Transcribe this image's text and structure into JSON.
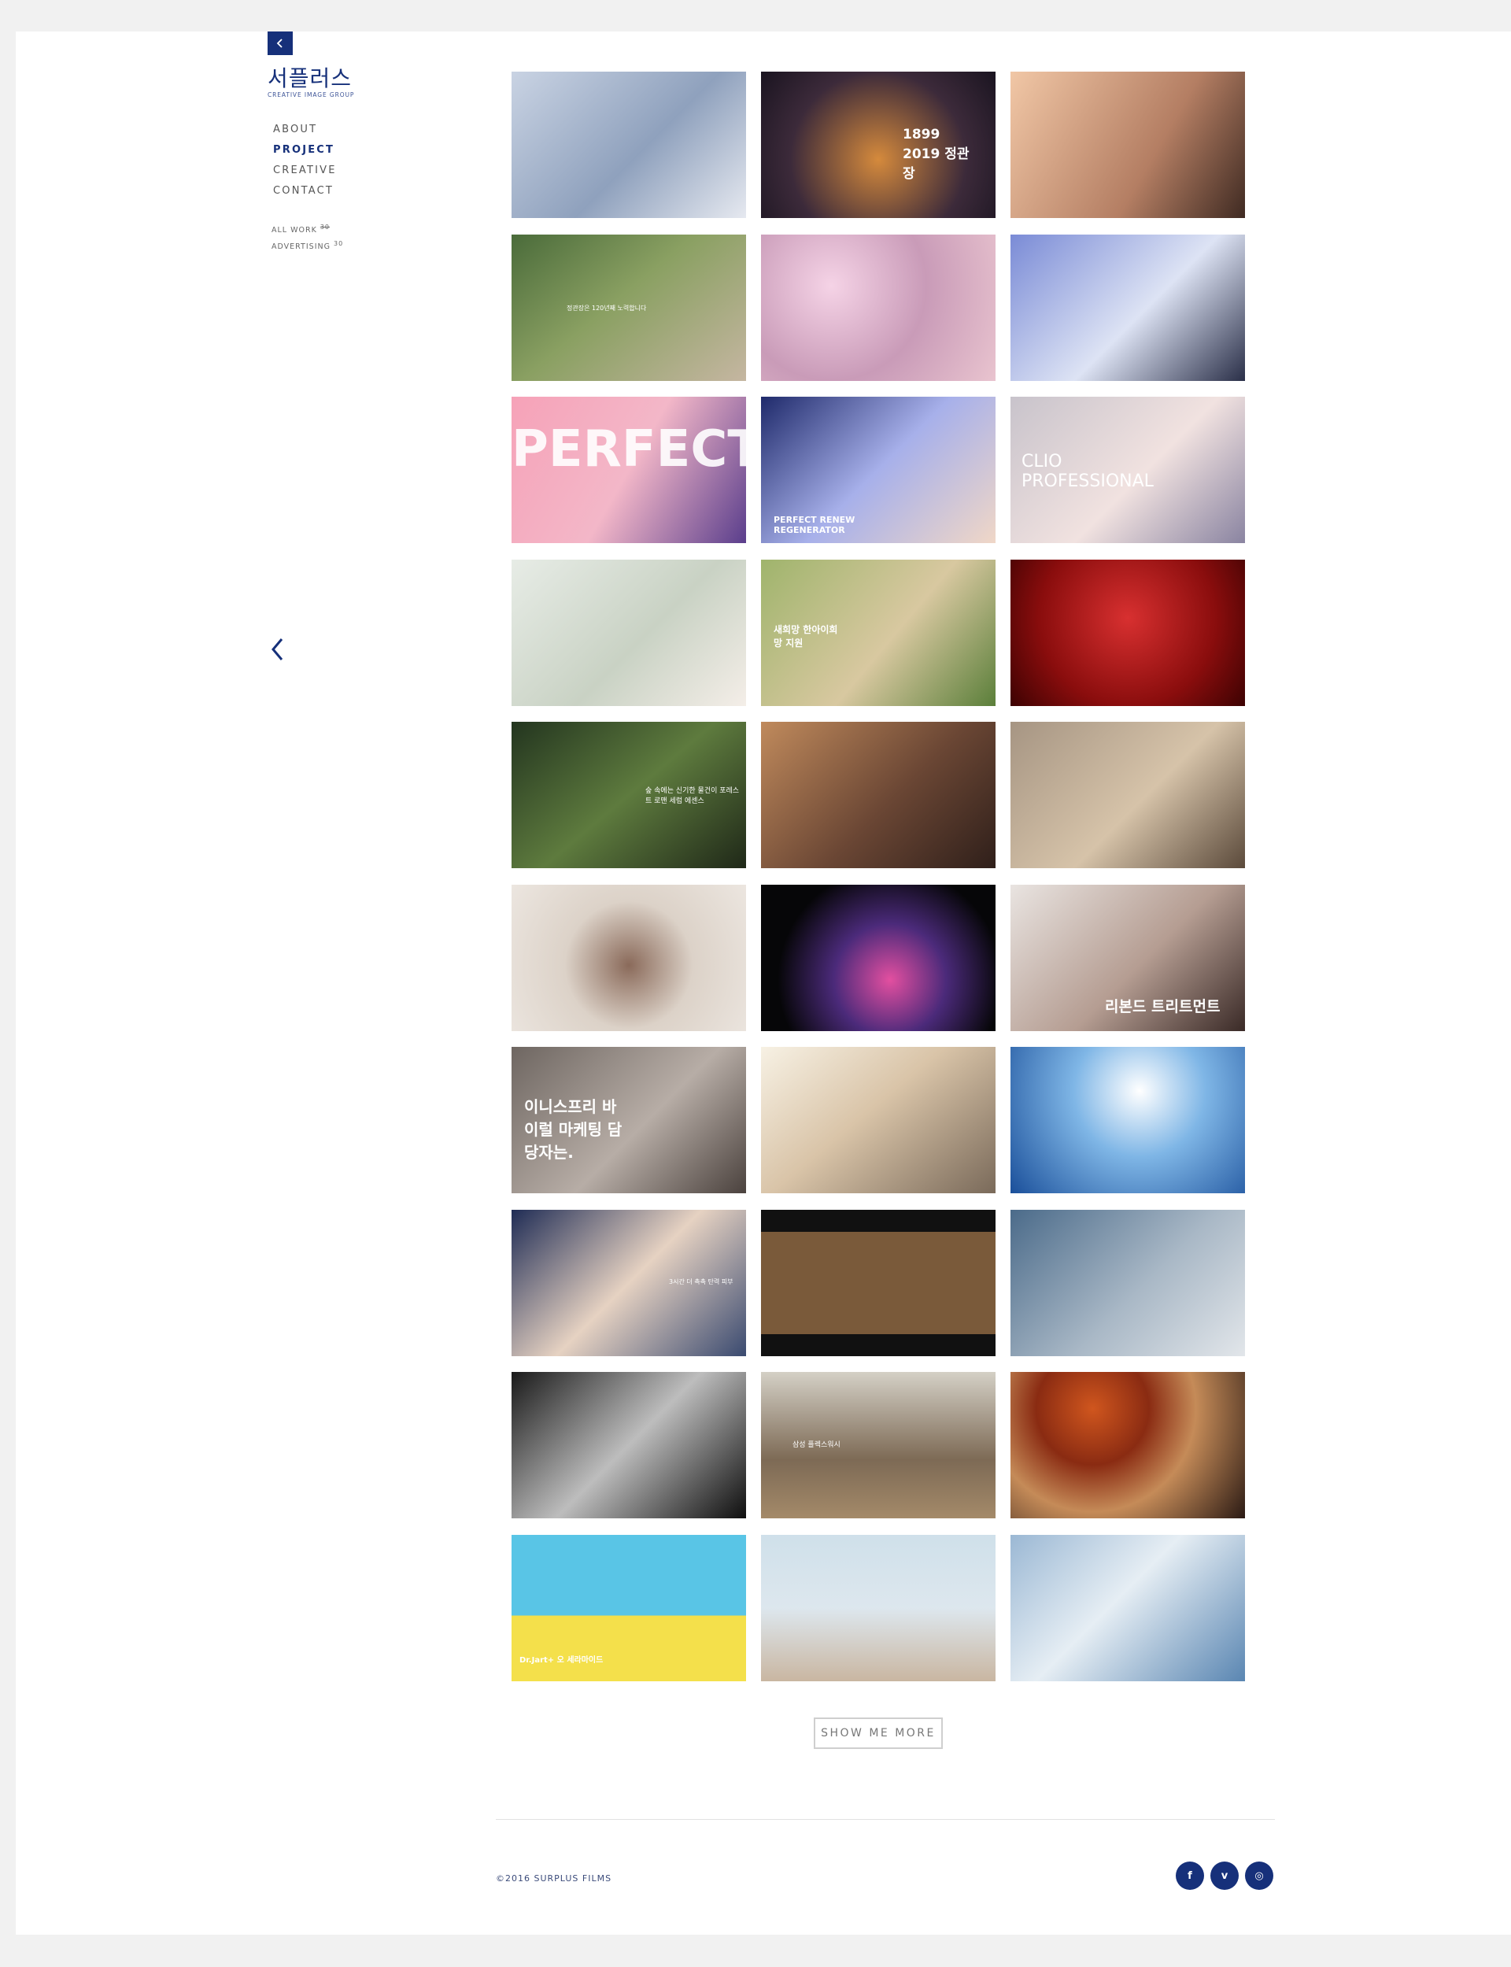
{
  "brand": {
    "name": "서플러스",
    "tagline": "CREATIVE IMAGE GROUP"
  },
  "nav": {
    "items": [
      {
        "label": "ABOUT"
      },
      {
        "label": "PROJECT"
      },
      {
        "label": "CREATIVE"
      },
      {
        "label": "CONTACT"
      }
    ],
    "active": "PROJECT"
  },
  "filters": {
    "all": {
      "label": "ALL WORK",
      "count": "30"
    },
    "advertising": {
      "label": "ADVERTISING",
      "count": "30"
    }
  },
  "icons": {
    "back": "chevron-left-icon",
    "prev": "chevron-left-icon",
    "facebook": "facebook-icon",
    "vimeo": "vimeo-icon",
    "instagram": "instagram-icon"
  },
  "colors": {
    "accent": "#16307a",
    "page_background": "#f1f1f1"
  },
  "thumbnails": [
    {
      "caption": ""
    },
    {
      "caption": "1899 2019 정관장"
    },
    {
      "caption": ""
    },
    {
      "caption": "정관장은 120년째 노력합니다"
    },
    {
      "caption": ""
    },
    {
      "caption": ""
    },
    {
      "caption": "PERFECT"
    },
    {
      "caption": "PERFECT RENEW REGENERATOR"
    },
    {
      "caption": "CLIO PROFESSIONAL"
    },
    {
      "caption": ""
    },
    {
      "caption": "새희망 한아이희망 지원"
    },
    {
      "caption": ""
    },
    {
      "caption": "숲 속에는 신기한 물건이 포레스트 로맨 세럼 에센스"
    },
    {
      "caption": ""
    },
    {
      "caption": ""
    },
    {
      "caption": ""
    },
    {
      "caption": ""
    },
    {
      "caption": "리본드 트리트먼트"
    },
    {
      "caption": "이니스프리 바이럴 마케팅 담당자는."
    },
    {
      "caption": ""
    },
    {
      "caption": ""
    },
    {
      "caption": "3시간 더 촉촉 탄력 피부"
    },
    {
      "caption": ""
    },
    {
      "caption": ""
    },
    {
      "caption": ""
    },
    {
      "caption": "삼성 플렉스워시"
    },
    {
      "caption": ""
    },
    {
      "caption": "Dr.Jart+ 오 세라마이드"
    },
    {
      "caption": ""
    },
    {
      "caption": ""
    }
  ],
  "more_button": {
    "label": "SHOW ME MORE"
  },
  "footer": {
    "copyright": "©2016 SURPLUS FILMS",
    "social": [
      "f",
      "v",
      "◎"
    ]
  }
}
